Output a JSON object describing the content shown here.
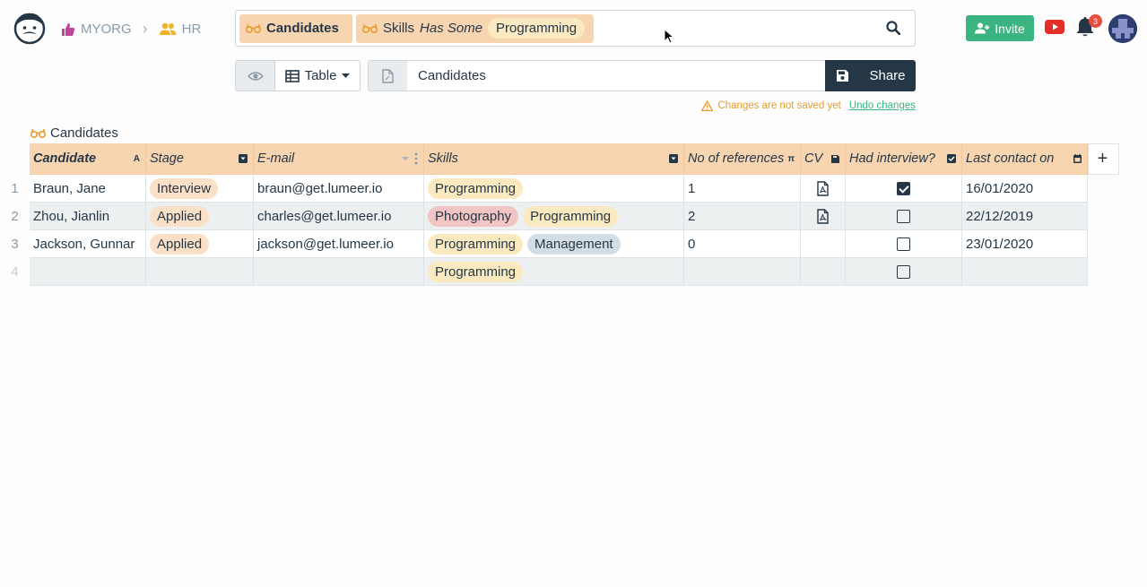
{
  "header": {
    "breadcrumb": [
      {
        "label": "MYORG",
        "icon": "thumbs-up-icon"
      },
      {
        "label": "HR",
        "icon": "users-icon"
      }
    ],
    "search": {
      "collection_chip": "Candidates",
      "filter": {
        "attribute": "Skills",
        "condition": "Has Some",
        "value": "Programming"
      }
    },
    "invite_label": "Invite",
    "notification_count": "3"
  },
  "toolbar": {
    "perspective_label": "Table",
    "view_name": "Candidates",
    "share_label": "Share"
  },
  "notice": {
    "text": "Changes are not saved yet",
    "undo_label": "Undo changes"
  },
  "table": {
    "title": "Candidates",
    "columns": [
      {
        "label": "Candidate",
        "icon": "A"
      },
      {
        "label": "Stage",
        "icon": "dropdown"
      },
      {
        "label": "E-mail",
        "icon": "sort"
      },
      {
        "label": "Skills",
        "icon": "dropdown"
      },
      {
        "label": "No of references",
        "icon": "π"
      },
      {
        "label": "CV",
        "icon": "file"
      },
      {
        "label": "Had interview?",
        "icon": "checkbox"
      },
      {
        "label": "Last contact on",
        "icon": "calendar"
      }
    ],
    "rows": [
      {
        "num": "1",
        "candidate": "Braun, Jane",
        "stage": "Interview",
        "email": "braun@get.lumeer.io",
        "skills": [
          "Programming"
        ],
        "refs": "1",
        "cv": true,
        "interview": true,
        "last_contact": "16/01/2020"
      },
      {
        "num": "2",
        "candidate": "Zhou, Jianlin",
        "stage": "Applied",
        "email": "charles@get.lumeer.io",
        "skills": [
          "Photography",
          "Programming"
        ],
        "refs": "2",
        "cv": true,
        "interview": false,
        "last_contact": "22/12/2019"
      },
      {
        "num": "3",
        "candidate": "Jackson, Gunnar",
        "stage": "Applied",
        "email": "jackson@get.lumeer.io",
        "skills": [
          "Programming",
          "Management"
        ],
        "refs": "0",
        "cv": false,
        "interview": false,
        "last_contact": "23/01/2020"
      },
      {
        "num": "4",
        "candidate": "",
        "stage": "",
        "email": "",
        "skills": [
          "Programming"
        ],
        "refs": "",
        "cv": false,
        "interview": false,
        "last_contact": ""
      }
    ]
  }
}
